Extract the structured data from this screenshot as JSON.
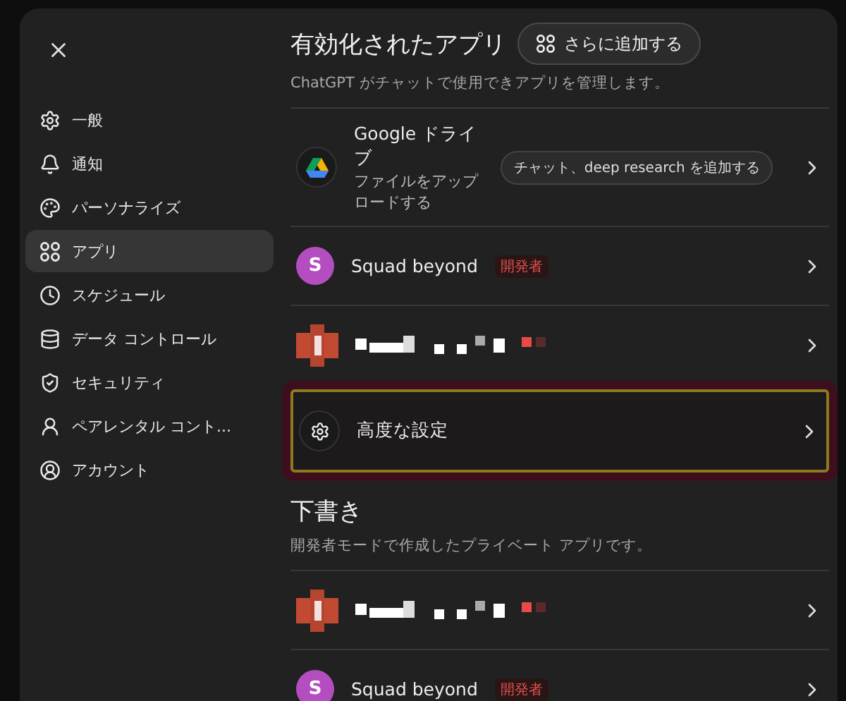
{
  "sidebar": {
    "items": [
      {
        "label": "一般",
        "selected": false
      },
      {
        "label": "通知",
        "selected": false
      },
      {
        "label": "パーソナライズ",
        "selected": false
      },
      {
        "label": "アプリ",
        "selected": true
      },
      {
        "label": "スケジュール",
        "selected": false
      },
      {
        "label": "データ コントロール",
        "selected": false
      },
      {
        "label": "セキュリティ",
        "selected": false
      },
      {
        "label": "ペアレンタル コント...",
        "selected": false
      },
      {
        "label": "アカウント",
        "selected": false
      }
    ]
  },
  "sections": [
    {
      "title": "有効化されたアプリ",
      "button": "さらに追加する",
      "subtitle": "ChatGPT がチャットで使用できアプリを管理します。",
      "rows": [
        {
          "kind": "drive",
          "name": "Google ドライブ",
          "description": "ファイルをアップロードする",
          "action": "チャット、deep research を追加する",
          "highlighted": false
        },
        {
          "kind": "avatar",
          "avatar": "S",
          "name": "Squad beyond",
          "badge": "開発者",
          "highlighted": false
        },
        {
          "kind": "redacted",
          "highlighted": false
        },
        {
          "kind": "settings",
          "name": "高度な設定",
          "highlighted": true
        }
      ]
    },
    {
      "title": "下書き",
      "subtitle": "開発者モードで作成したプライベート アプリです。",
      "rows": [
        {
          "kind": "redacted",
          "highlighted": false
        },
        {
          "kind": "avatar",
          "avatar": "S",
          "name": "Squad beyond",
          "badge": "開発者",
          "highlighted": false
        }
      ]
    }
  ]
}
